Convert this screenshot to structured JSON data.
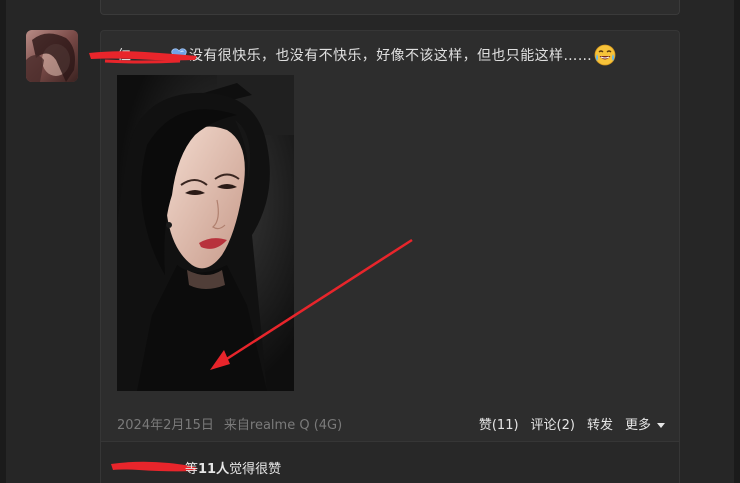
{
  "post": {
    "text": "没有很快乐，也没有不快乐，好像不该这样，但也只能这样……",
    "date": "2024年2月15日",
    "source": "来自realme Q (4G)",
    "username_fragment": "仁"
  },
  "actions": {
    "like": "赞(11)",
    "comment": "评论(2)",
    "repost": "转发",
    "more": "更多"
  },
  "likes": {
    "prefix": "等",
    "count": "11人",
    "suffix": "觉得很赞"
  },
  "icons": {
    "heart": "heart-icon",
    "emoji": "laughing-crying-emoji-icon",
    "more": "caret-down-icon"
  },
  "colors": {
    "background": "#262626",
    "card": "#2d2d2d",
    "redaction": "#e8252b",
    "meta_text": "#7a7a7a"
  }
}
